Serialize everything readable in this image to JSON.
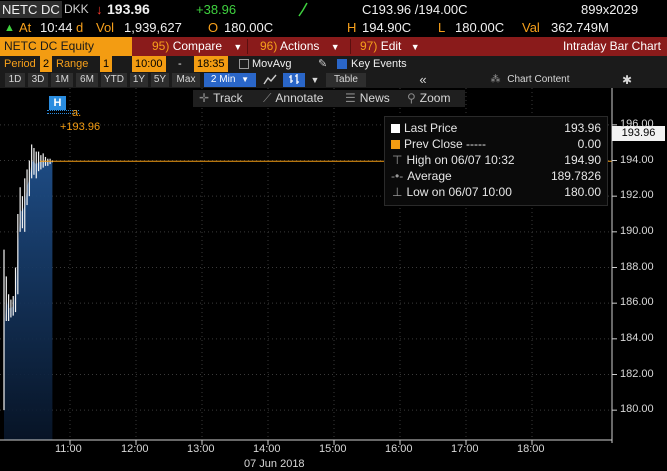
{
  "quote": {
    "ticker": "NETC DC",
    "exchange": "DKK",
    "arrow": "↓",
    "last": "193.96",
    "change": "+38.96",
    "bid_ask": "C193.96 /194.00C",
    "size": "899x2029",
    "at_label": "At",
    "time": "10:44",
    "time_flag": "d",
    "vol_label": "Vol",
    "volume": "1,939,627",
    "open_label": "O",
    "open": "180.00C",
    "high_label": "H",
    "high": "194.90C",
    "low_label": "L",
    "low": "180.00C",
    "val_label": "Val",
    "value": "362.749M"
  },
  "menubar": {
    "ticker_label": "NETC DC Equity",
    "compare_num": "95)",
    "compare_label": "Compare",
    "actions_num": "96)",
    "actions_label": "Actions",
    "edit_num": "97)",
    "edit_label": "Edit",
    "title": "Intraday Bar Chart"
  },
  "periodbar": {
    "period_label": "Period",
    "period_value": "2",
    "range_label": "Range",
    "range_value": "1",
    "range_start": "10:00",
    "range_dash": "-",
    "range_end": "18:35",
    "movavg_label": "MovAvg",
    "keyevents_label": "Key Events"
  },
  "rangebar": {
    "buttons": [
      "1D",
      "3D",
      "1M",
      "6M",
      "YTD",
      "1Y",
      "5Y",
      "Max"
    ],
    "interval": "2 Min",
    "table_label": "Table",
    "collapse_label": "«",
    "chart_content_label": "Chart Content",
    "settings_icon": "gear-icon"
  },
  "toolbar": {
    "track": "Track",
    "annotate": "Annotate",
    "news": "News",
    "zoom": "Zoom"
  },
  "legend": {
    "last_price_label": "Last Price",
    "last_price_value": "193.96",
    "prev_close_label": "Prev Close -----",
    "prev_close_value": "0.00",
    "high_label": "High on 06/07 10:32",
    "high_value": "194.90",
    "average_label": "Average",
    "average_value": "189.7826",
    "low_label": "Low on 06/07 10:00",
    "low_value": "180.00",
    "last_price_color": "#ffffff",
    "prev_close_color": "#f39c12"
  },
  "event_marker": {
    "label": "H",
    "note": "a.",
    "price_tag": "+193.96"
  },
  "price_tag": "193.96",
  "y_axis": [
    "196.00",
    "194.00",
    "192.00",
    "190.00",
    "188.00",
    "186.00",
    "184.00",
    "182.00",
    "180.00"
  ],
  "x_axis": [
    "11:00",
    "12:00",
    "13:00",
    "14:00",
    "15:00",
    "16:00",
    "17:00",
    "18:00"
  ],
  "date_label": "07 Jun 2018",
  "chart_data": {
    "type": "bar",
    "x_start": "10:00",
    "x_end": "10:44",
    "y_range": [
      179,
      197
    ],
    "last_price": 193.96,
    "bars": [
      {
        "lo": 180.0,
        "hi": 189.0
      },
      {
        "lo": 185.0,
        "hi": 187.5
      },
      {
        "lo": 185.0,
        "hi": 186.5
      },
      {
        "lo": 185.2,
        "hi": 186.2
      },
      {
        "lo": 185.3,
        "hi": 186.4
      },
      {
        "lo": 185.5,
        "hi": 188.0
      },
      {
        "lo": 186.5,
        "hi": 191.0
      },
      {
        "lo": 190.0,
        "hi": 192.5
      },
      {
        "lo": 190.2,
        "hi": 192.0
      },
      {
        "lo": 190.0,
        "hi": 193.0
      },
      {
        "lo": 191.5,
        "hi": 193.5
      },
      {
        "lo": 192.0,
        "hi": 194.0
      },
      {
        "lo": 193.0,
        "hi": 194.9
      },
      {
        "lo": 193.2,
        "hi": 194.7
      },
      {
        "lo": 193.0,
        "hi": 194.5
      },
      {
        "lo": 193.4,
        "hi": 194.5
      },
      {
        "lo": 193.5,
        "hi": 194.3
      },
      {
        "lo": 193.6,
        "hi": 194.4
      },
      {
        "lo": 193.7,
        "hi": 194.2
      },
      {
        "lo": 193.7,
        "hi": 194.1
      },
      {
        "lo": 193.8,
        "hi": 194.1
      },
      {
        "lo": 193.9,
        "hi": 194.0
      }
    ]
  }
}
